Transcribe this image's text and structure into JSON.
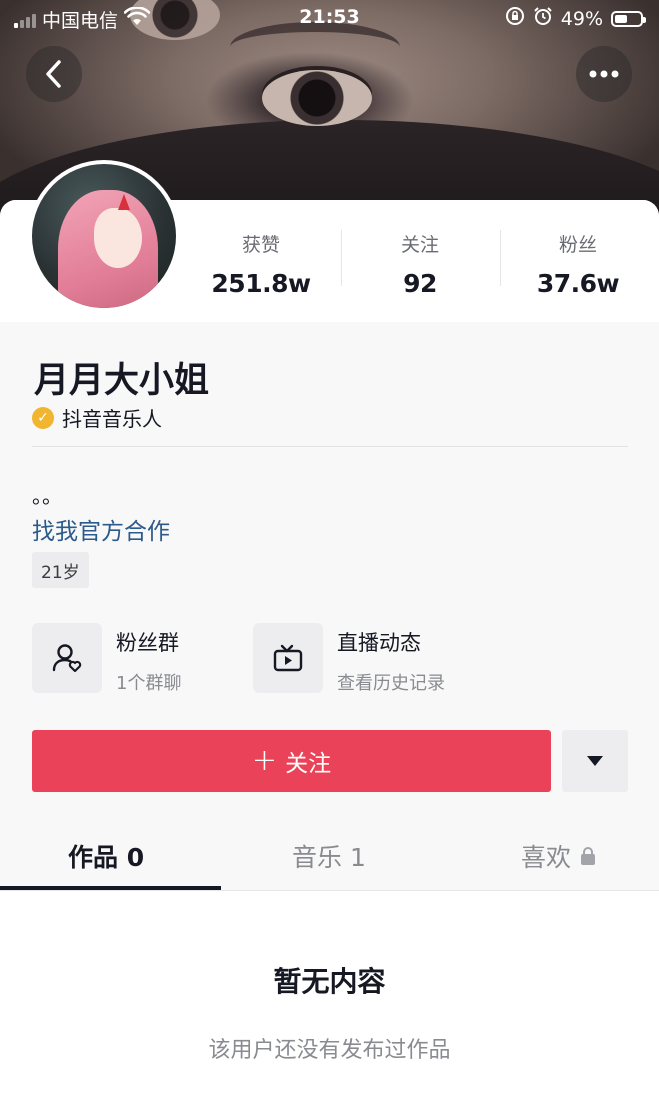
{
  "status_bar": {
    "carrier": "中国电信",
    "time": "21:53",
    "battery_percent": "49%",
    "battery_level": 0.49,
    "icons": [
      "signal-icon",
      "wifi-icon",
      "orientation-lock-icon",
      "alarm-icon",
      "battery-icon"
    ]
  },
  "nav": {
    "back_icon": "chevron-left-icon",
    "more_icon": "ellipsis-icon"
  },
  "profile": {
    "name": "月月大小姐",
    "verified_label": "抖音音乐人",
    "verified_mark": "✓",
    "bio": "。。",
    "cooperation_link": "找我官方合作",
    "age_tag": "21岁"
  },
  "stats": {
    "likes_label": "获赞",
    "likes_value": "251.8w",
    "following_label": "关注",
    "following_value": "92",
    "fans_label": "粉丝",
    "fans_value": "37.6w"
  },
  "features": {
    "fan_group_title": "粉丝群",
    "fan_group_sub": "1个群聊",
    "live_title": "直播动态",
    "live_sub": "查看历史记录"
  },
  "actions": {
    "follow_plus": "+",
    "follow_label": "关注"
  },
  "tabs": {
    "works": "作品 0",
    "music": "音乐 1",
    "likes": "喜欢"
  },
  "empty_state": {
    "title": "暂无内容",
    "subtitle": "该用户还没有发布过作品"
  },
  "colors": {
    "accent": "#ea4359",
    "link": "#2c5a8a",
    "verified": "#f1b52f"
  }
}
